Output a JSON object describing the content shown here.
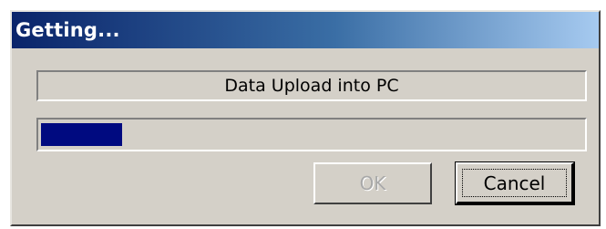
{
  "window": {
    "title": "Getting..."
  },
  "status": {
    "text": "Data Upload into PC"
  },
  "progress": {
    "fraction": 0.15
  },
  "buttons": {
    "ok_label": "OK",
    "ok_enabled": false,
    "cancel_label": "Cancel",
    "cancel_focused": true
  },
  "colors": {
    "titlebar_start": "#0a246a",
    "titlebar_end": "#a6caf0",
    "progress_fill": "#000a80",
    "dialog_face": "#d4d0c8"
  }
}
